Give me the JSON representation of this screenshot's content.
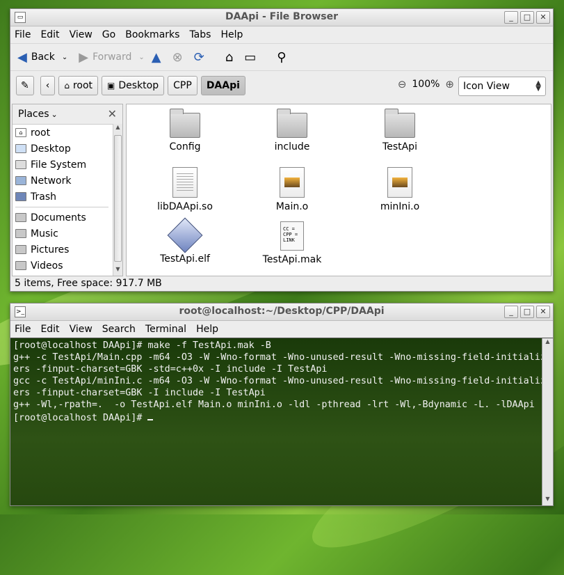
{
  "file_browser": {
    "title": "DAApi - File Browser",
    "menu": [
      "File",
      "Edit",
      "View",
      "Go",
      "Bookmarks",
      "Tabs",
      "Help"
    ],
    "toolbar": {
      "back": "Back",
      "forward": "Forward"
    },
    "breadcrumbs": [
      "root",
      "Desktop",
      "CPP",
      "DAApi"
    ],
    "zoom_level": "100%",
    "view_mode": "Icon View",
    "sidebar": {
      "header": "Places",
      "places": [
        "root",
        "Desktop",
        "File System",
        "Network",
        "Trash"
      ],
      "bookmarks": [
        "Documents",
        "Music",
        "Pictures",
        "Videos"
      ]
    },
    "files": [
      {
        "name": "Config",
        "type": "folder"
      },
      {
        "name": "include",
        "type": "folder"
      },
      {
        "name": "TestApi",
        "type": "folder"
      },
      {
        "name": "libDAApi.so",
        "type": "library"
      },
      {
        "name": "Main.o",
        "type": "object"
      },
      {
        "name": "minIni.o",
        "type": "object"
      },
      {
        "name": "TestApi.elf",
        "type": "executable"
      },
      {
        "name": "TestApi.mak",
        "type": "makefile"
      }
    ],
    "mak_preview": [
      "CC =",
      "CPP =",
      "LINK"
    ],
    "status": "5 items, Free space: 917.7 MB"
  },
  "terminal": {
    "title": "root@localhost:~/Desktop/CPP/DAApi",
    "menu": [
      "File",
      "Edit",
      "View",
      "Search",
      "Terminal",
      "Help"
    ],
    "lines": [
      "[root@localhost DAApi]# make -f TestApi.mak -B",
      "g++ -c TestApi/Main.cpp -m64 -O3 -W -Wno-format -Wno-unused-result -Wno-missing-field-initializ",
      "ers -finput-charset=GBK -std=c++0x -I include -I TestApi",
      "gcc -c TestApi/minIni.c -m64 -O3 -W -Wno-format -Wno-unused-result -Wno-missing-field-initializ",
      "ers -finput-charset=GBK -I include -I TestApi",
      "g++ -Wl,-rpath=.  -o TestApi.elf Main.o minIni.o -ldl -pthread -lrt -Wl,-Bdynamic -L. -lDAApi"
    ],
    "prompt": "[root@localhost DAApi]# "
  }
}
